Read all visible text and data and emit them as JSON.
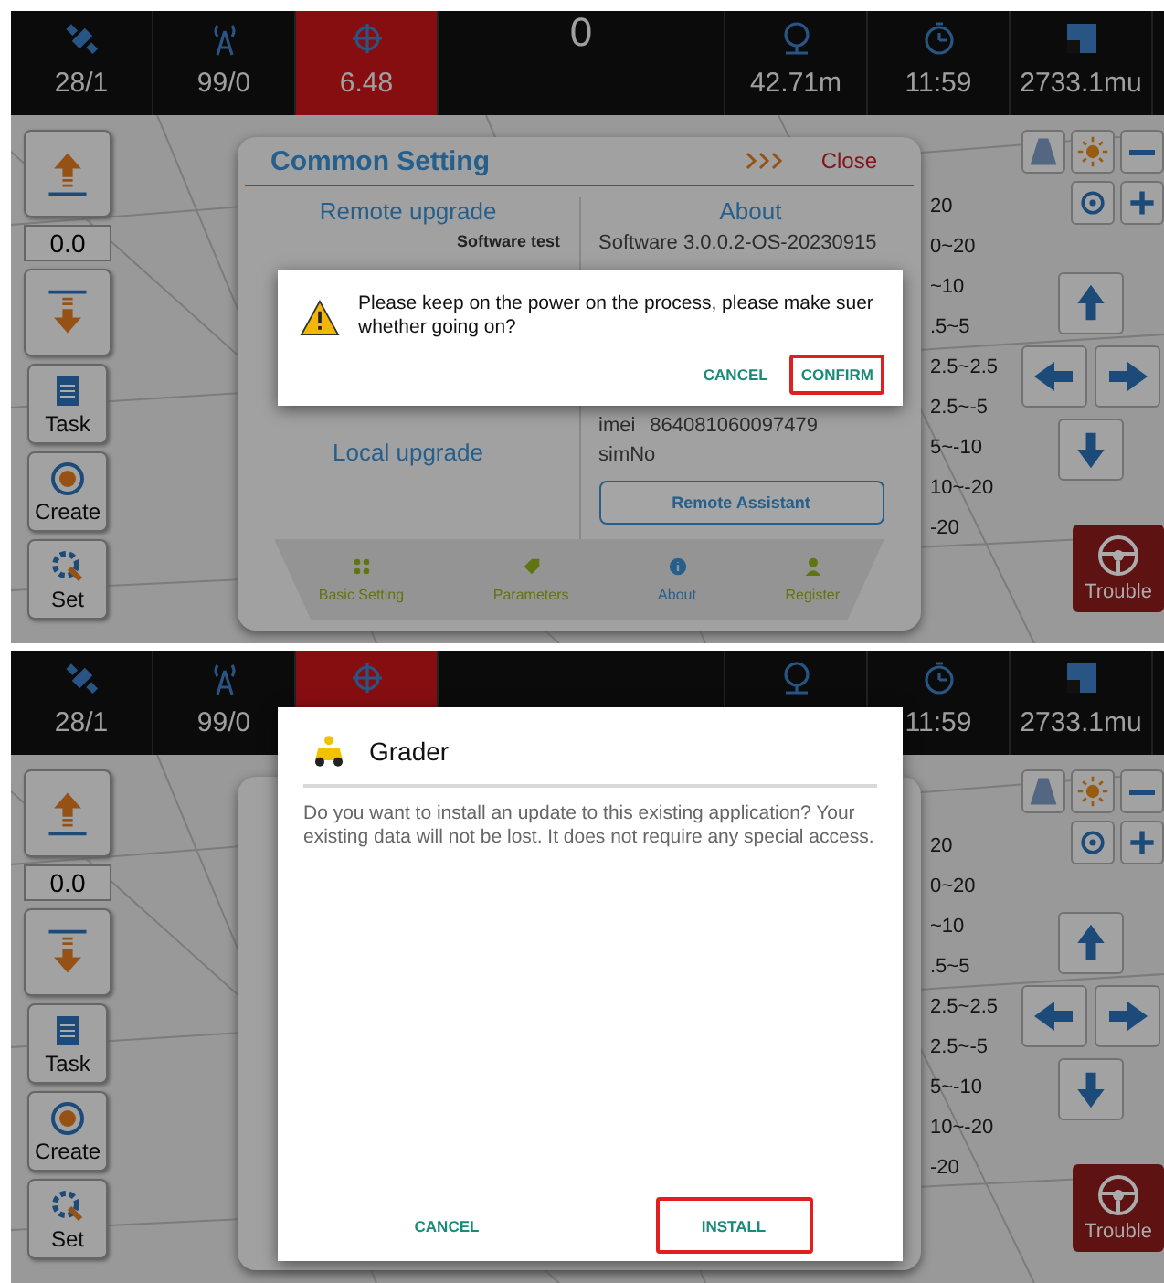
{
  "screens": [
    {
      "status_bar": [
        {
          "value": "28/1",
          "alert": false
        },
        {
          "value": "99/0",
          "alert": false
        },
        {
          "value": "6.48",
          "alert": true
        },
        {
          "value": "0",
          "alert": false
        },
        {
          "value": "42.71m",
          "alert": false
        },
        {
          "value": "11:59",
          "alert": false
        },
        {
          "value": "2733.1mu",
          "alert": false
        }
      ],
      "offset_value": "0.0",
      "tools": [
        "Task",
        "Create",
        "Set"
      ],
      "scale_labels": [
        "20",
        "0~20",
        "~10",
        ".5~5",
        "2.5~2.5",
        "2.5~-5",
        "5~-10",
        "10~-20",
        "-20"
      ],
      "trouble_label": "Trouble",
      "settings_panel": {
        "title": "Common Setting",
        "close": "Close",
        "left_heading": "Remote upgrade",
        "right_heading": "About",
        "test_label": "Software test",
        "software": "Software  3.0.0.2-OS-20230915",
        "imei_label": "imei",
        "imei": "864081060097479",
        "sim_label": "simNo",
        "local_upgrade": "Local upgrade",
        "remote_button": "Remote Assistant",
        "tabs": [
          {
            "label": "Basic Setting",
            "selected": false
          },
          {
            "label": "Parameters",
            "selected": false
          },
          {
            "label": "About",
            "selected": true
          },
          {
            "label": "Register",
            "selected": false
          }
        ]
      },
      "dialog": {
        "kind": "warning",
        "message": "Please keep on the power on the process, please make suer whether going on?",
        "buttons": [
          {
            "label": "CANCEL",
            "highlighted": false
          },
          {
            "label": "CONFIRM",
            "highlighted": true
          }
        ]
      }
    },
    {
      "status_bar": [
        {
          "value": "28/1",
          "alert": false
        },
        {
          "value": "99/0",
          "alert": false
        },
        {
          "alert": true
        },
        {
          "alert": false
        },
        {
          "alert": false
        },
        {
          "value": "11:59",
          "alert": false
        },
        {
          "value": "2733.1mu",
          "alert": false
        }
      ],
      "offset_value": "0.0",
      "tools": [
        "Task",
        "Create",
        "Set"
      ],
      "scale_labels": [
        "20",
        "0~20",
        "~10",
        ".5~5",
        "2.5~2.5",
        "2.5~-5",
        "5~-10",
        "10~-20",
        "-20"
      ],
      "trouble_label": "Trouble",
      "dialog": {
        "kind": "install",
        "title": "Grader",
        "message": "Do you want to install an update to this existing application? Your existing data will not be lost. It does not require any special access.",
        "buttons": [
          {
            "label": "CANCEL",
            "highlighted": false
          },
          {
            "label": "INSTALL",
            "highlighted": true
          }
        ]
      }
    }
  ]
}
